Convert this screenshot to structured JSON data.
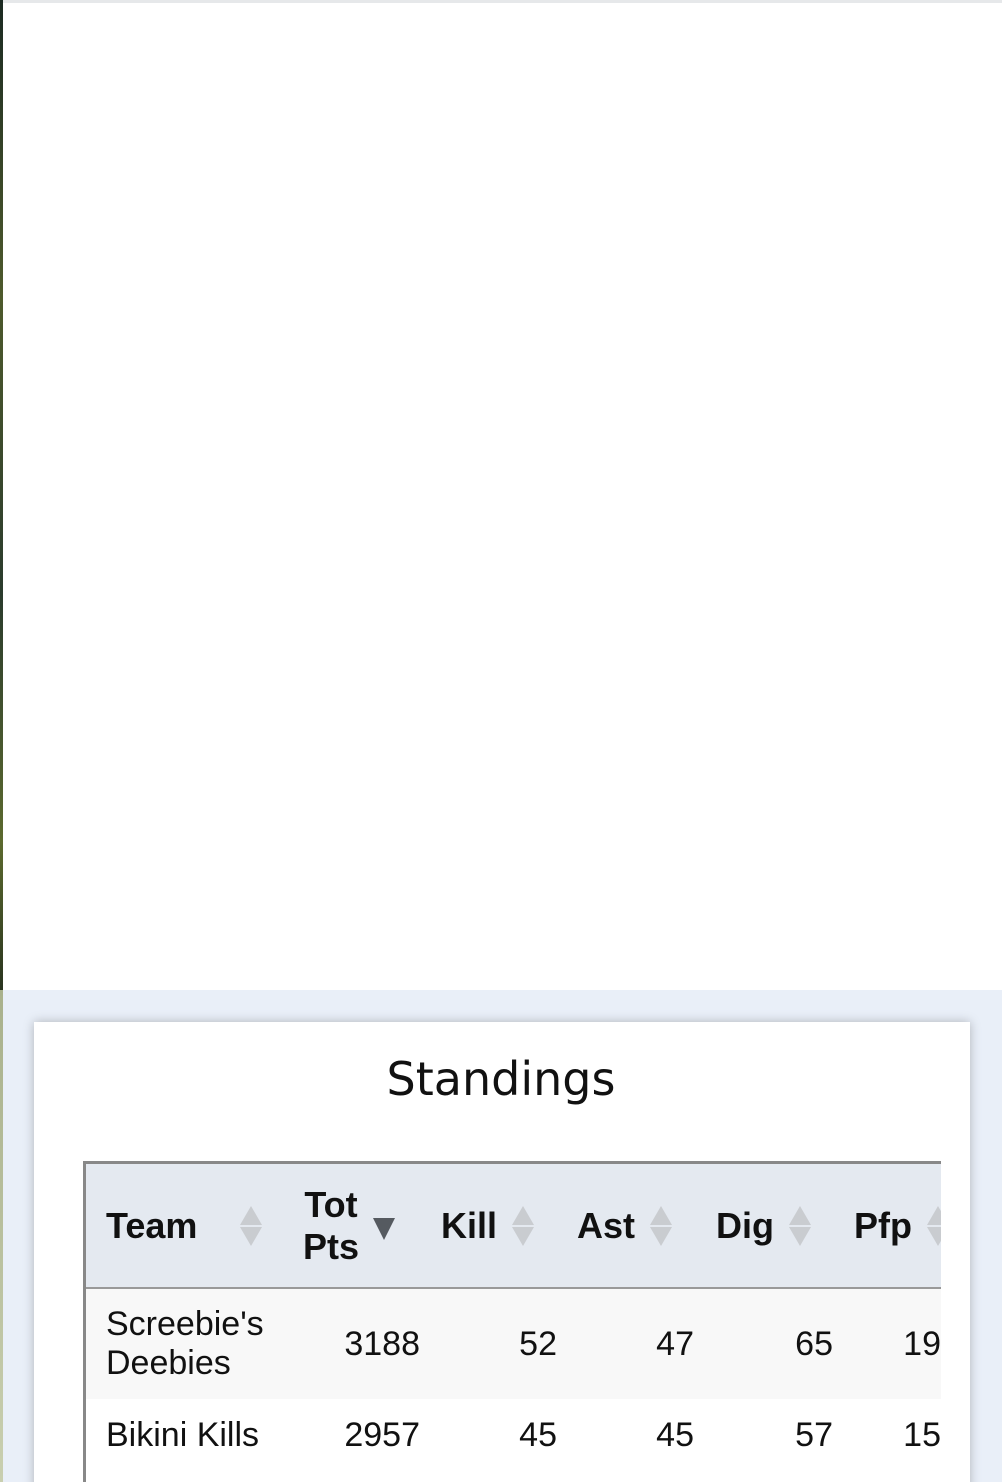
{
  "card": {
    "title": "Standings"
  },
  "table": {
    "headers": [
      {
        "label_line1": "Team",
        "label_line2": "",
        "sort": "none"
      },
      {
        "label_line1": "Tot",
        "label_line2": "Pts",
        "sort": "desc"
      },
      {
        "label_line1": "Kill",
        "label_line2": "",
        "sort": "none"
      },
      {
        "label_line1": "Ast",
        "label_line2": "",
        "sort": "none"
      },
      {
        "label_line1": "Dig",
        "label_line2": "",
        "sort": "none"
      },
      {
        "label_line1": "Pfp",
        "label_line2": "",
        "sort": "none"
      }
    ],
    "rows": [
      {
        "team_line1": "Screebie's",
        "team_line2": "Deebies",
        "tot_pts": "3188",
        "kill": "52",
        "ast": "47",
        "dig": "65",
        "pfp": "19"
      },
      {
        "team_line1": "Bikini Kills",
        "team_line2": "",
        "tot_pts": "2957",
        "kill": "45",
        "ast": "45",
        "dig": "57",
        "pfp": "15"
      }
    ]
  },
  "colors": {
    "header_bg": "#e4e9f0",
    "band_bg": "#e9eff8",
    "sort_active": "#555a60",
    "sort_inactive": "#c9ccd0"
  }
}
